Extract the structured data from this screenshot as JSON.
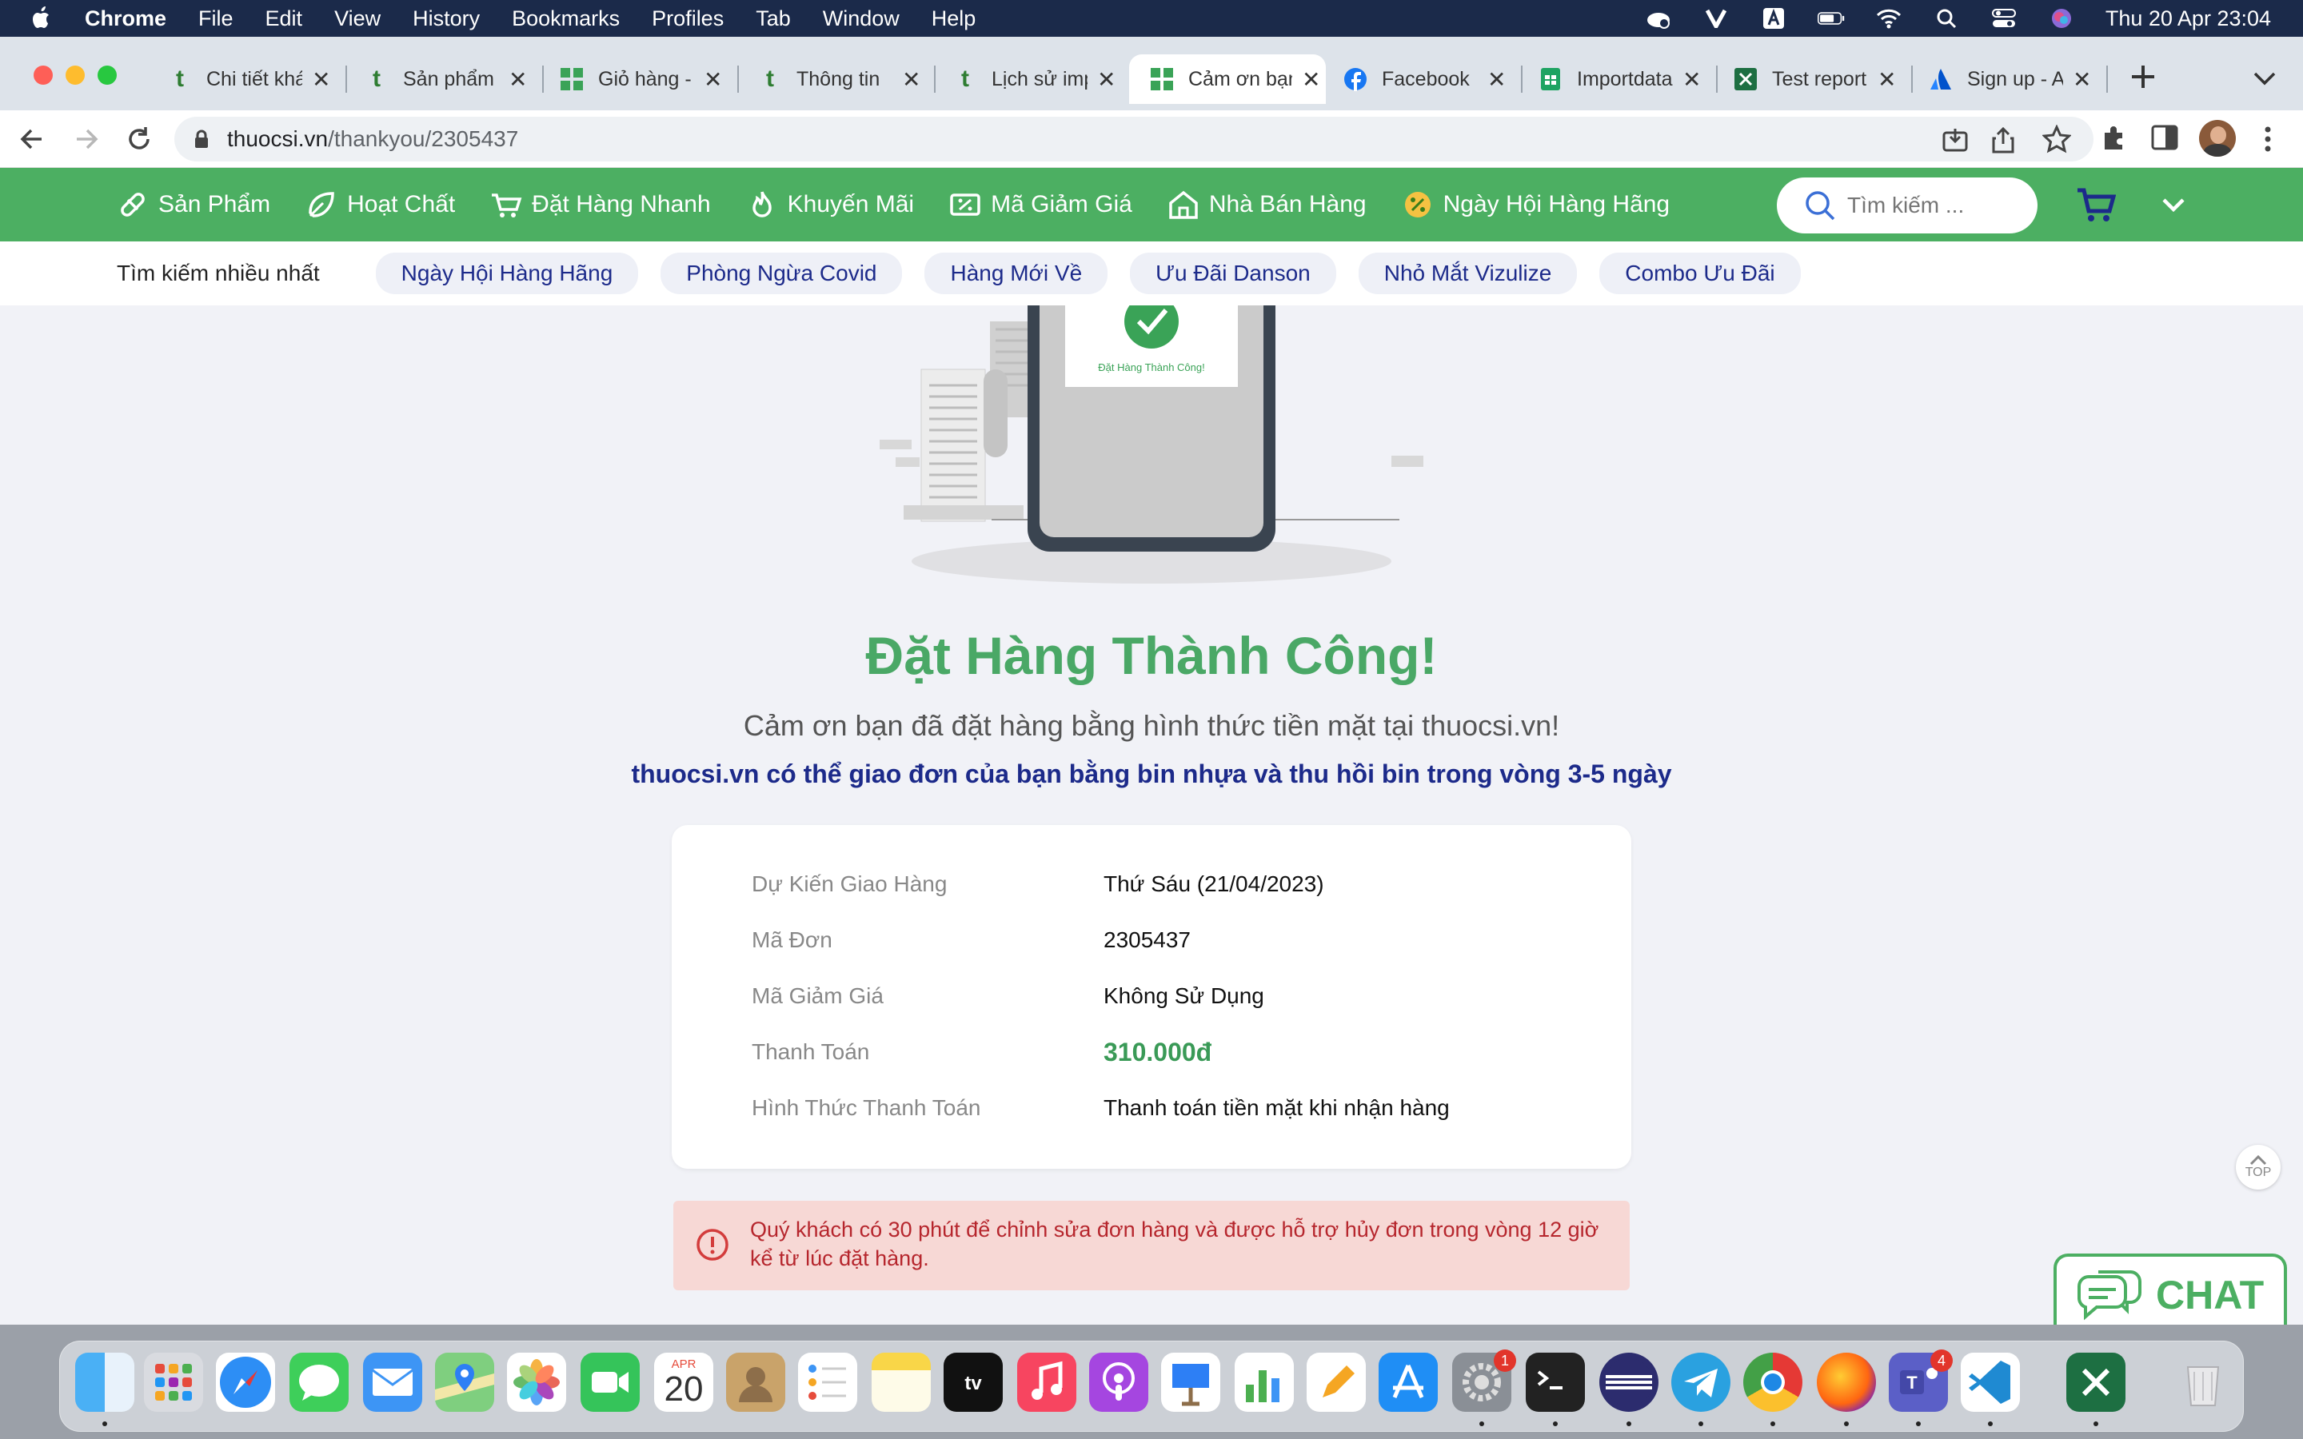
{
  "menubar": {
    "app": "Chrome",
    "items": [
      "File",
      "Edit",
      "View",
      "History",
      "Bookmarks",
      "Profiles",
      "Tab",
      "Window",
      "Help"
    ],
    "datetime": "Thu 20 Apr  23:04",
    "status_icons": [
      "cloud-icon",
      "v-icon",
      "input-source-icon",
      "battery-icon",
      "wifi-icon",
      "spotlight-icon",
      "control-center-icon",
      "siri-icon"
    ]
  },
  "tabs": [
    {
      "title": "Chi tiết khách hàng",
      "favicon": "t"
    },
    {
      "title": "Sản phẩm",
      "favicon": "t"
    },
    {
      "title": "Giỏ hàng - thuocsi",
      "favicon": "grid"
    },
    {
      "title": "Thông tin",
      "favicon": "t"
    },
    {
      "title": "Lịch sử import",
      "favicon": "t"
    },
    {
      "title": "Cảm ơn bạn",
      "favicon": "grid",
      "active": true
    },
    {
      "title": "Facebook",
      "favicon": "f"
    },
    {
      "title": "Importdata",
      "favicon": "sheets"
    },
    {
      "title": "Test report",
      "favicon": "excel"
    },
    {
      "title": "Sign up - Atlassian",
      "favicon": "atlassian"
    }
  ],
  "address": {
    "domain": "thuocsi.vn",
    "path": "/thankyou/2305437"
  },
  "nav": {
    "items": [
      "Sản Phẩm",
      "Hoạt Chất",
      "Đặt Hàng Nhanh",
      "Khuyến Mãi",
      "Mã Giảm Giá",
      "Nhà Bán Hàng",
      "Ngày Hội Hàng Hãng"
    ],
    "search_placeholder": "Tìm kiếm ..."
  },
  "trending": {
    "label": "Tìm kiếm nhiều nhất",
    "chips": [
      "Ngày Hội Hàng Hãng",
      "Phòng Ngừa Covid",
      "Hàng Mới Về",
      "Ưu Đãi Danson",
      "Nhỏ Mắt Vizulize",
      "Combo Ưu Đãi"
    ]
  },
  "illustration": {
    "caption": "Đặt Hàng Thành Công!"
  },
  "page": {
    "title": "Đặt Hàng Thành Công!",
    "subtitle": "Cảm ơn bạn đã đặt hàng bằng hình thức tiền mặt tại thuocsi.vn!",
    "note": "thuocsi.vn có thể giao đơn của bạn bằng bin nhựa và thu hồi bin trong vòng 3-5 ngày"
  },
  "order": {
    "rows": [
      {
        "label": "Dự Kiến Giao Hàng",
        "value": "Thứ Sáu (21/04/2023)"
      },
      {
        "label": "Mã Đơn",
        "value": "2305437"
      },
      {
        "label": "Mã Giảm Giá",
        "value": "Không Sử Dụng"
      },
      {
        "label": "Thanh Toán",
        "value": "310.000đ"
      },
      {
        "label": "Hình Thức Thanh Toán",
        "value": "Thanh toán tiền mặt khi nhận hàng"
      }
    ]
  },
  "alert": {
    "message": "Quý khách có 30 phút để chỉnh sửa đơn hàng và được hỗ trợ hủy đơn trong vòng 12 giờ kể từ lúc đặt hàng."
  },
  "widgets": {
    "top_label": "TOP",
    "chat_label": "CHAT"
  },
  "dock": {
    "apps": [
      "Finder",
      "Launchpad",
      "Safari",
      "Messages",
      "Mail",
      "Maps",
      "Photos",
      "FaceTime",
      "Calendar",
      "Contacts",
      "Reminders",
      "Notes",
      "TV",
      "Music",
      "Podcasts",
      "Keynote",
      "Numbers",
      "Pages",
      "App Store",
      "System Settings",
      "Terminal",
      "Eclipse",
      "Telegram",
      "Chrome",
      "Firefox",
      "Teams",
      "VS Code",
      "Excel",
      "Trash"
    ],
    "calendar_month": "APR",
    "calendar_day": "20",
    "badges": {
      "system_settings": "1",
      "teams": "4"
    }
  },
  "colors": {
    "brand_green": "#4caf62",
    "success_green": "#4aa866",
    "navy": "#1c2a8a",
    "alert_bg": "#f7d8d5",
    "alert_text": "#b6262d"
  }
}
